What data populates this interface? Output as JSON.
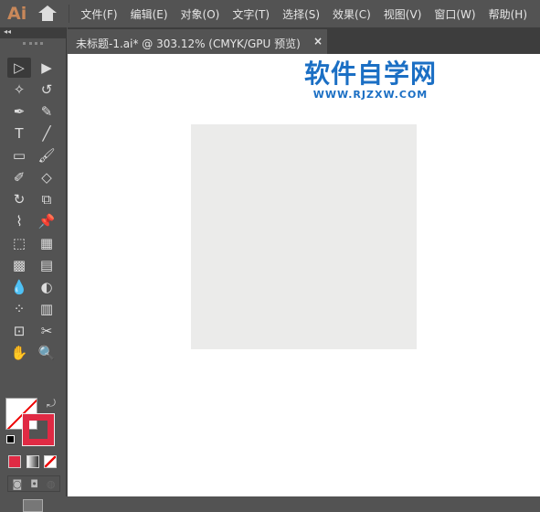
{
  "app": {
    "logo": "Ai",
    "home_icon": "home-icon"
  },
  "menu": [
    "文件(F)",
    "编辑(E)",
    "对象(O)",
    "文字(T)",
    "选择(S)",
    "效果(C)",
    "视图(V)",
    "窗口(W)",
    "帮助(H)"
  ],
  "document_tab": {
    "title": "未标题-1.ai* @ 303.12% (CMYK/GPU 预览)",
    "close": "×"
  },
  "watermark": {
    "title": "软件自学网",
    "url": "WWW.RJZXW.COM"
  },
  "toolbar": {
    "collapse": "◂◂",
    "tools": [
      [
        "selection",
        "▷"
      ],
      [
        "direct-selection",
        "▶"
      ],
      [
        "magic-wand",
        "✧"
      ],
      [
        "lasso",
        "↺"
      ],
      [
        "pen",
        "✒"
      ],
      [
        "curvature",
        "✎"
      ],
      [
        "type",
        "T"
      ],
      [
        "line-segment",
        "╱"
      ],
      [
        "rectangle",
        "▭"
      ],
      [
        "paintbrush",
        "🖌"
      ],
      [
        "shaper",
        "✐"
      ],
      [
        "eraser",
        "◇"
      ],
      [
        "rotate",
        "↻"
      ],
      [
        "scale",
        "⧉"
      ],
      [
        "width",
        "⌇"
      ],
      [
        "puppet-warp",
        "📌"
      ],
      [
        "free-transform",
        "⬚"
      ],
      [
        "perspective-grid",
        "▦"
      ],
      [
        "mesh",
        "▩"
      ],
      [
        "gradient",
        "▤"
      ],
      [
        "eyedropper",
        "💧"
      ],
      [
        "blend",
        "◐"
      ],
      [
        "symbol-sprayer",
        "⁘"
      ],
      [
        "column-graph",
        "▥"
      ],
      [
        "artboard",
        "⊡"
      ],
      [
        "slice",
        "✂"
      ],
      [
        "hand",
        "✋"
      ],
      [
        "zoom",
        "🔍"
      ]
    ]
  },
  "colors": {
    "fill": "#ffffff",
    "stroke": "#e02a44",
    "accent": "#1b6fc4"
  }
}
